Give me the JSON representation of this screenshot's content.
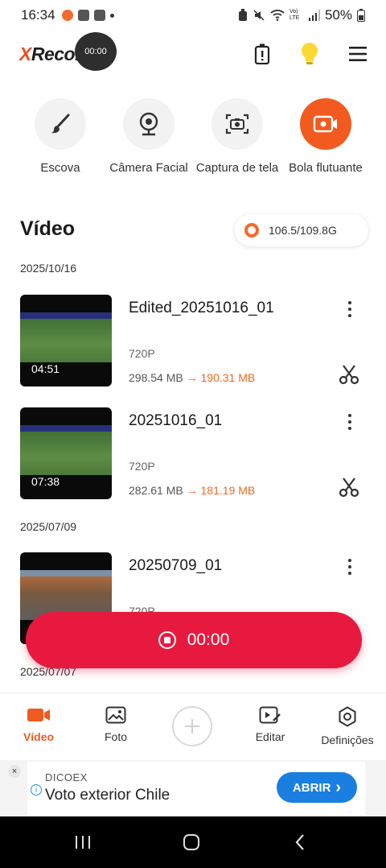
{
  "status_bar": {
    "time": "16:34",
    "battery": "50%",
    "network_label": "Vo) LTE"
  },
  "header": {
    "logo_prefix": "X",
    "logo_rest": "Recorder",
    "floating_timer": "00:00",
    "icons": [
      "battery-alert-icon",
      "lightbulb-icon",
      "menu-icon"
    ]
  },
  "tools": [
    {
      "label": "Escova",
      "icon": "brush-icon",
      "active": false
    },
    {
      "label": "Câmera Facial",
      "icon": "webcam-icon",
      "active": false
    },
    {
      "label": "Captura de tela",
      "icon": "screenshot-camera-icon",
      "active": false
    },
    {
      "label": "Bola flutuante",
      "icon": "floating-ball-icon",
      "active": true
    }
  ],
  "section": {
    "title": "Vídeo",
    "storage": "106.5/109.8G"
  },
  "groups": [
    {
      "date": "2025/10/16",
      "videos": [
        {
          "title": "Edited_20251016_01",
          "resolution": "720P",
          "size_original": "298.54 MB",
          "arrow": "→",
          "size_compressed": "190.31 MB",
          "duration": "04:51"
        },
        {
          "title": "20251016_01",
          "resolution": "720P",
          "size_original": "282.61 MB",
          "arrow": "→",
          "size_compressed": "181.19 MB",
          "duration": "07:38"
        }
      ]
    },
    {
      "date": "2025/07/09",
      "videos": [
        {
          "title": "20250709_01",
          "resolution": "720P"
        }
      ]
    },
    {
      "date": "2025/07/07"
    }
  ],
  "record_button": {
    "label": "00:00"
  },
  "bottom_nav": [
    {
      "label": "Vídeo",
      "icon": "video-camera-icon",
      "active": true
    },
    {
      "label": "Foto",
      "icon": "photo-icon",
      "active": false
    },
    {
      "label": "",
      "icon": "plus-icon",
      "active": false
    },
    {
      "label": "Editar",
      "icon": "edit-video-icon",
      "active": false
    },
    {
      "label": "Definições",
      "icon": "settings-hex-icon",
      "active": false
    }
  ],
  "ad": {
    "close": "×",
    "brand": "DICOEX",
    "headline": "Voto exterior Chile",
    "cta": "ABRIR",
    "cta_arrow": "›",
    "info": "i"
  },
  "colors": {
    "accent": "#ef5b21",
    "record": "#e8193f",
    "ad_cta": "#1a7fe0"
  }
}
